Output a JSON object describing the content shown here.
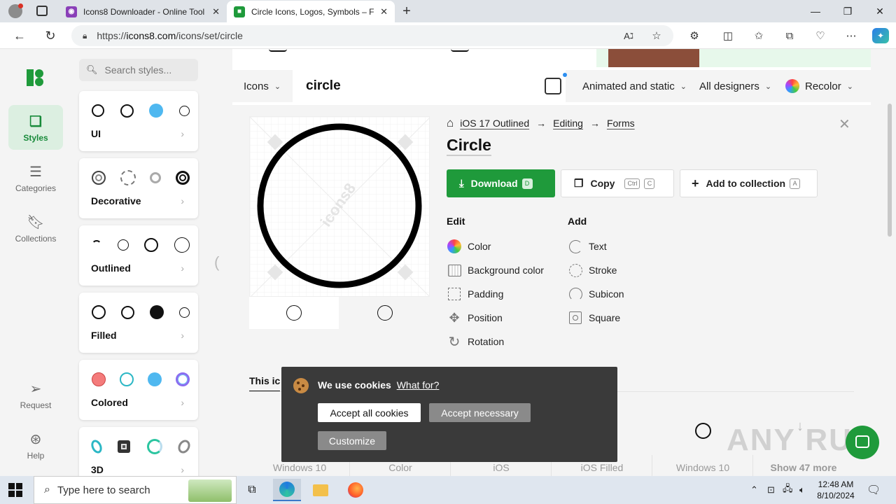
{
  "browser": {
    "tabs": [
      {
        "title": "Icons8 Downloader - Online Tool",
        "active": false
      },
      {
        "title": "Circle Icons, Logos, Symbols – Free",
        "active": true
      }
    ],
    "new_tab": "+",
    "url_prefix": "https://",
    "url_host": "icons8.com",
    "url_path": "/icons/set/circle"
  },
  "leftnav": {
    "items": [
      {
        "label": "Styles",
        "icon": "styles-icon",
        "active": true
      },
      {
        "label": "Categories",
        "icon": "list-icon"
      },
      {
        "label": "Collections",
        "icon": "bookmark-icon"
      },
      {
        "label": "Request",
        "icon": "send-icon"
      },
      {
        "label": "Help",
        "icon": "lifebuoy-icon"
      }
    ]
  },
  "styles_panel": {
    "search_placeholder": "Search styles...",
    "cards": [
      {
        "label": "UI"
      },
      {
        "label": "Decorative"
      },
      {
        "label": "Outlined"
      },
      {
        "label": "Filled"
      },
      {
        "label": "Colored"
      },
      {
        "label": "3D"
      }
    ],
    "chevron": "›"
  },
  "searchbar": {
    "type_label": "Icons",
    "query": "circle",
    "filters": [
      "Animated and static",
      "All designers",
      "Recolor"
    ]
  },
  "detail": {
    "breadcrumb": [
      "iOS 17 Outlined",
      "Editing",
      "Forms"
    ],
    "arrow": "→",
    "title": "Circle",
    "watermark": "icons8",
    "buttons": {
      "download": "Download",
      "download_key": "D",
      "copy": "Copy",
      "copy_keys": [
        "Ctrl",
        "C"
      ],
      "collection": "Add to collection",
      "collection_key": "A"
    },
    "edit_heading": "Edit",
    "edit_items": [
      "Color",
      "Background color",
      "Padding",
      "Position",
      "Rotation"
    ],
    "add_heading": "Add",
    "add_items": [
      "Text",
      "Stroke",
      "Subicon",
      "Square"
    ]
  },
  "section": {
    "tab_label": "This ic",
    "variants": [
      "Windows 10",
      "Color",
      "iOS",
      "iOS Filled",
      "Windows 10",
      "Show 47 more"
    ]
  },
  "cookie": {
    "title": "We use cookies",
    "link": "What for?",
    "accept_all": "Accept all cookies",
    "accept_necessary": "Accept necessary",
    "customize": "Customize"
  },
  "watermark": "ANY RUN",
  "taskbar": {
    "search_placeholder": "Type here to search",
    "time": "12:48 AM",
    "date": "8/10/2024"
  },
  "colors": {
    "brand_green": "#1f9a3b",
    "icon_blue": "#4fb8f0",
    "icon_red": "#f47b7b",
    "icon_teal": "#2bb7c5"
  }
}
